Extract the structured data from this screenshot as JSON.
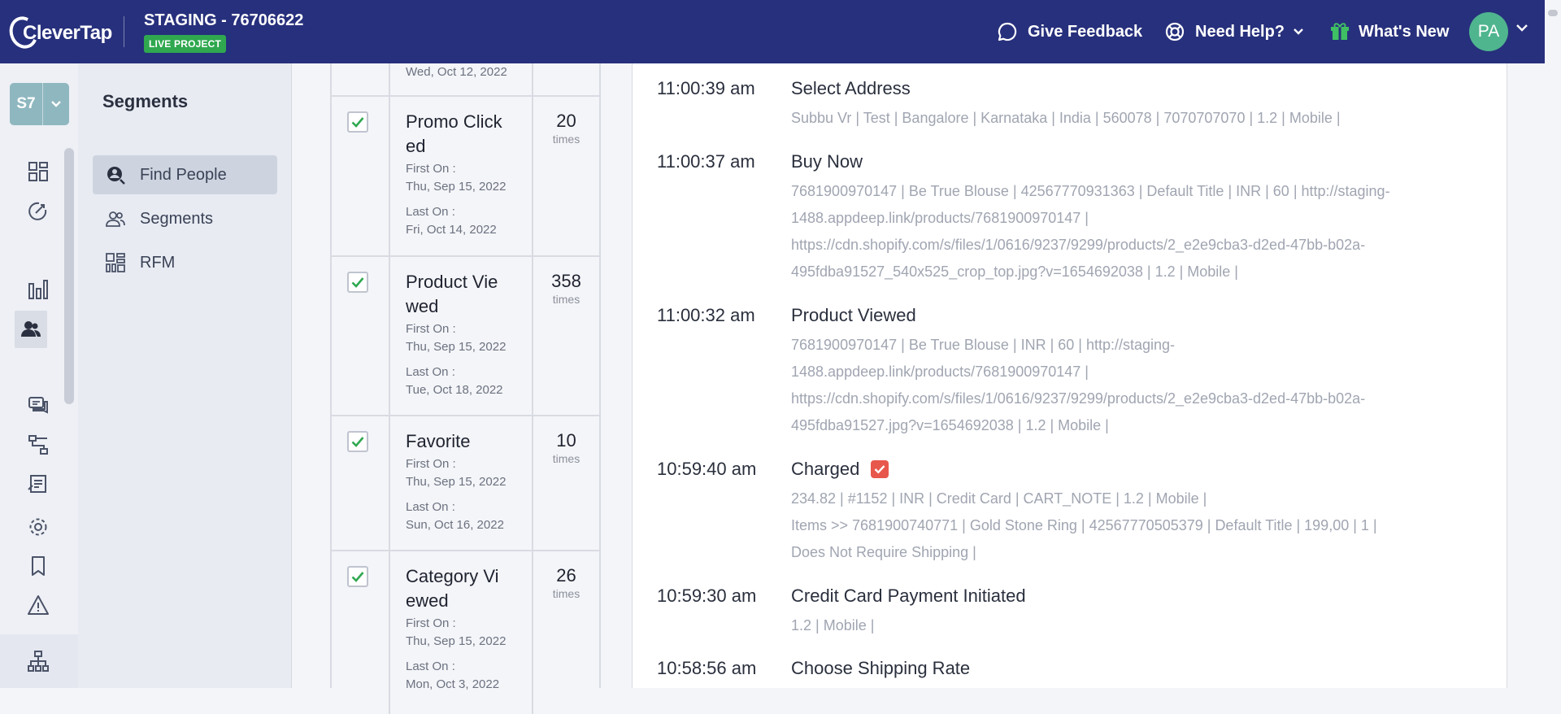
{
  "header": {
    "logo_text": "CleverTap",
    "project_name": "STAGING - 76706622",
    "project_badge": "LIVE PROJECT",
    "give_feedback": "Give Feedback",
    "need_help": "Need Help?",
    "whats_new": "What's New",
    "avatar_initials": "PA"
  },
  "rail": {
    "project_code": "S7",
    "icons": [
      "dashboard-icon",
      "analytics-tools-icon",
      "charts-icon",
      "segments-people-icon",
      "messages-icon",
      "journeys-icon",
      "campaign-list-icon",
      "settings-icon",
      "bookmark-icon",
      "alert-icon",
      "org-hierarchy-icon"
    ]
  },
  "segments_panel": {
    "title": "Segments",
    "items": [
      {
        "label": "Find People",
        "icon": "find-people-icon",
        "active": true
      },
      {
        "label": "Segments",
        "icon": "people-group-icon",
        "active": false
      },
      {
        "label": "RFM",
        "icon": "rfm-grid-icon",
        "active": false
      }
    ]
  },
  "events_table": {
    "partial_top_date": "Wed, Oct 12, 2022",
    "first_on_label": "First On :",
    "last_on_label": "Last On :",
    "times_label": "times",
    "rows": [
      {
        "name_line1": "Promo Click",
        "name_line2": "ed",
        "first_on": "Thu, Sep 15, 2022",
        "last_on": "Fri, Oct 14, 2022",
        "count": "20",
        "checked": true
      },
      {
        "name_line1": "Product Vie",
        "name_line2": "wed",
        "first_on": "Thu, Sep 15, 2022",
        "last_on": "Tue, Oct 18, 2022",
        "count": "358",
        "checked": true
      },
      {
        "name_line1": "Favorite",
        "name_line2": "",
        "first_on": "Thu, Sep 15, 2022",
        "last_on": "Sun, Oct 16, 2022",
        "count": "10",
        "checked": true
      },
      {
        "name_line1": "Category Vi",
        "name_line2": "ewed",
        "first_on": "Thu, Sep 15, 2022",
        "last_on": "Mon, Oct 3, 2022",
        "count": "26",
        "checked": true
      }
    ]
  },
  "activity": [
    {
      "time": "11:00:39 am",
      "event": "Select Address",
      "props": [
        "Subbu Vr  |  Test  |  Bangalore  |  Karnataka  |  India  |  560078  |  7070707070  |  1.2  |  Mobile  |"
      ]
    },
    {
      "time": "11:00:37 am",
      "event": "Buy Now",
      "props": [
        "7681900970147  |  Be True Blouse  |  42567770931363  |  Default Title  |  INR  |  60  |  http://staging-",
        "1488.appdeep.link/products/7681900970147  |",
        "https://cdn.shopify.com/s/files/1/0616/9237/9299/products/2_e2e9cba3-d2ed-47bb-b02a-",
        "495fdba91527_540x525_crop_top.jpg?v=1654692038  |  1.2  |  Mobile  |"
      ]
    },
    {
      "time": "11:00:32 am",
      "event": "Product Viewed",
      "props": [
        "7681900970147  |  Be True Blouse  |  INR  |  60  |  http://staging-",
        "1488.appdeep.link/products/7681900970147  |",
        "https://cdn.shopify.com/s/files/1/0616/9237/9299/products/2_e2e9cba3-d2ed-47bb-b02a-",
        "495fdba91527.jpg?v=1654692038  |  1.2  |  Mobile  |"
      ]
    },
    {
      "time": "10:59:40 am",
      "event": "Charged",
      "charged_icon": "checkbox-checked-icon",
      "props": [
        "234.82  |  #1152  |  INR  |  Credit Card  |  CART_NOTE  |  1.2  |  Mobile  |",
        "Items >> 7681900740771  |  Gold Stone Ring  |  42567770505379  |  Default Title  |  199,00  |  1  |",
        "Does Not Require Shipping  |"
      ]
    },
    {
      "time": "10:59:30 am",
      "event": "Credit Card Payment Initiated",
      "props": [
        "1.2  |  Mobile  |"
      ]
    },
    {
      "time": "10:58:56 am",
      "event": "Choose Shipping Rate",
      "props": []
    }
  ],
  "colors": {
    "topbar": "#27307c",
    "live_badge": "#2fa84f",
    "avatar": "#4fb58f",
    "check_green": "#2fa84f",
    "charged_red": "#e8574c"
  }
}
